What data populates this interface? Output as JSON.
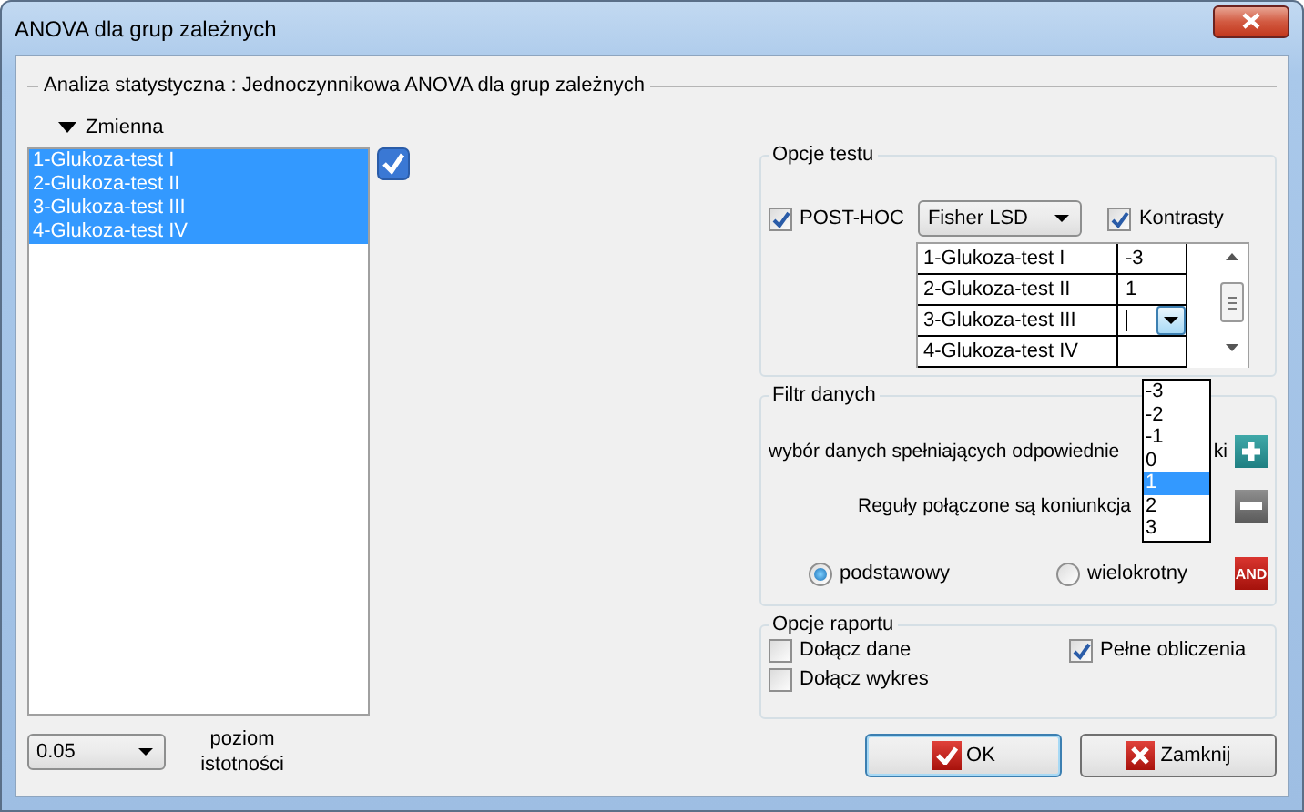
{
  "window": {
    "title": "ANOVA dla grup zależnych"
  },
  "analysis_title": "Analiza statystyczna : Jednoczynnikowa ANOVA dla grup zależnych",
  "variables": {
    "label": "Zmienna",
    "expanded": true,
    "select_all_checked": true,
    "items": [
      {
        "label": "1-Glukoza-test I",
        "selected": true
      },
      {
        "label": "2-Glukoza-test II",
        "selected": true
      },
      {
        "label": "3-Glukoza-test III",
        "selected": true
      },
      {
        "label": "4-Glukoza-test IV",
        "selected": true
      }
    ]
  },
  "significance": {
    "value": "0.05",
    "label": "poziom istotności"
  },
  "test_options": {
    "title": "Opcje testu",
    "post_hoc": {
      "label": "POST-HOC",
      "checked": true
    },
    "post_hoc_method": "Fisher LSD",
    "contrasts": {
      "label": "Kontrasty",
      "checked": true
    },
    "contrast_rows": [
      {
        "name": "1-Glukoza-test I",
        "weight": "-3",
        "editing": false
      },
      {
        "name": "2-Glukoza-test II",
        "weight": "1",
        "editing": false
      },
      {
        "name": "3-Glukoza-test III",
        "editing": true
      },
      {
        "name": "4-Glukoza-test IV",
        "editing": false
      }
    ],
    "weight_options": [
      {
        "label": "-3",
        "selected": false
      },
      {
        "label": "-2",
        "selected": false
      },
      {
        "label": "-1",
        "selected": false
      },
      {
        "label": "0",
        "selected": false
      },
      {
        "label": "1",
        "selected": true
      },
      {
        "label": "2",
        "selected": false
      },
      {
        "label": "3",
        "selected": false
      }
    ]
  },
  "data_filter": {
    "title": "Filtr danych",
    "selection_label": "wybór danych spełniających odpowiednie",
    "selection_label_tail": "ki",
    "rules_label": "Reguły połączone są koniunkcja",
    "and_label": "AND",
    "modes": [
      {
        "label": "podstawowy",
        "selected": true
      },
      {
        "label": "wielokrotny",
        "selected": false
      }
    ]
  },
  "report_options": {
    "title": "Opcje raportu",
    "options": [
      {
        "label": "Dołącz dane",
        "checked": false
      },
      {
        "label": "Dołącz wykres",
        "checked": false
      },
      {
        "label": "Pełne obliczenia",
        "checked": true
      }
    ]
  },
  "buttons": [
    {
      "label": "OK",
      "kind": "ok"
    },
    {
      "label": "Zamknij",
      "kind": "close"
    }
  ]
}
